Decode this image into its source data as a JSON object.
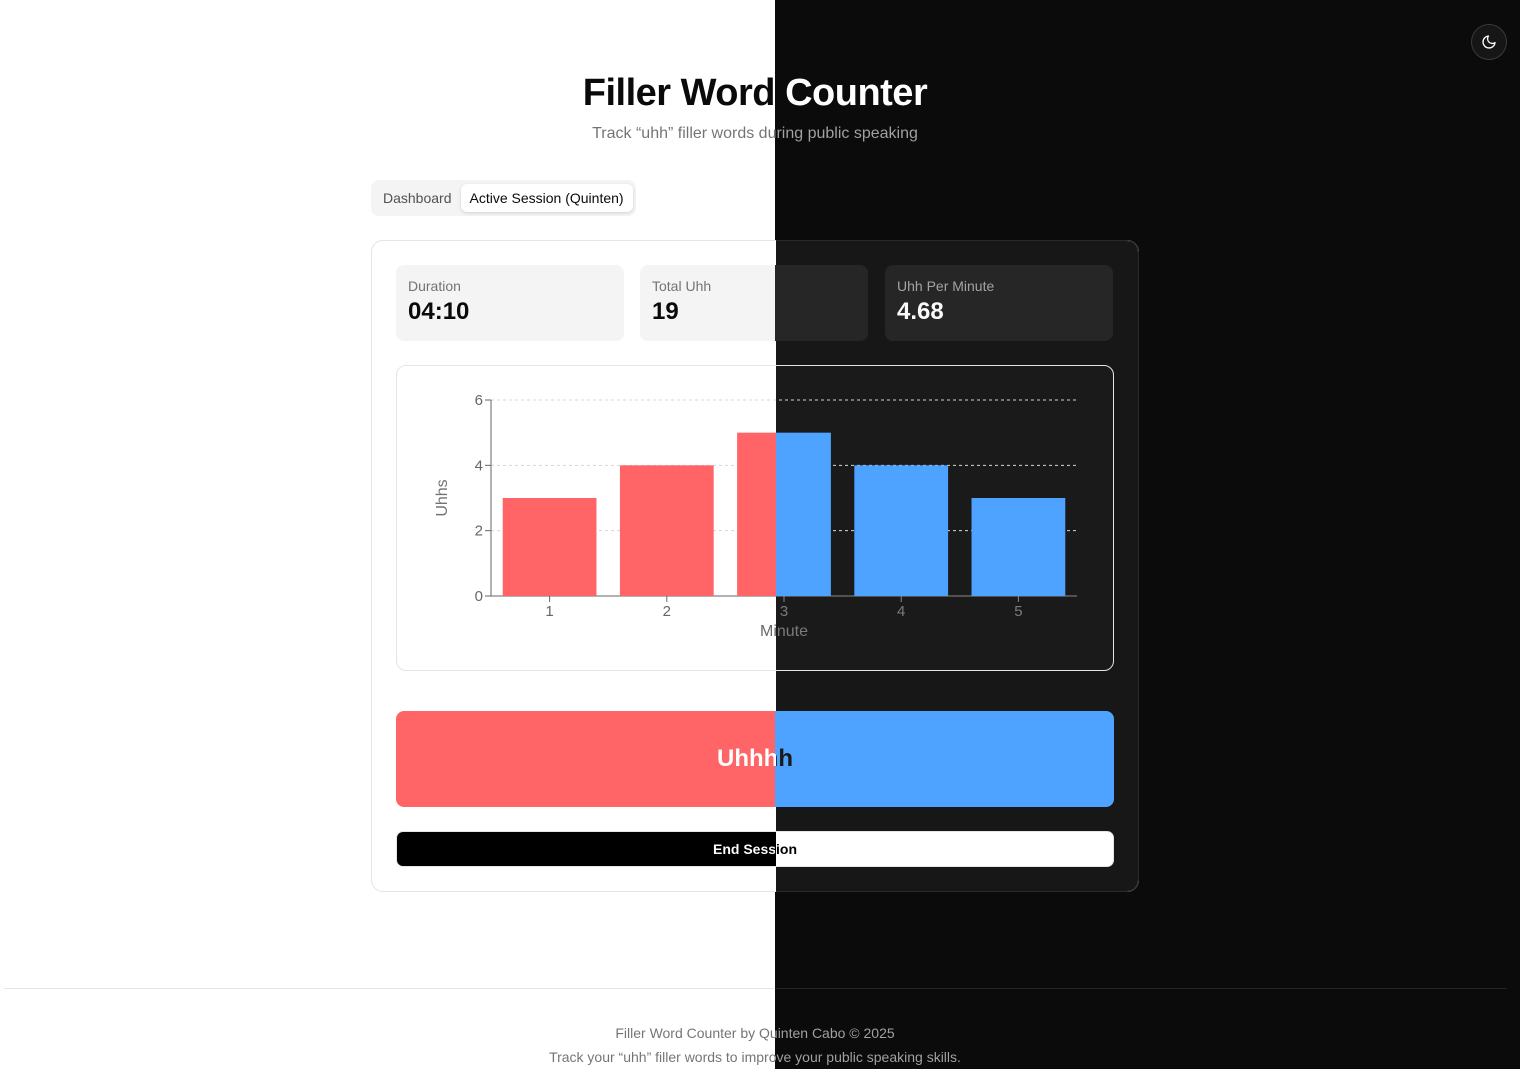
{
  "header": {
    "title": "Filler Word Counter",
    "subtitle": "Track “uhh” filler words during public speaking"
  },
  "theme_toggle": {
    "icon": "moon-icon"
  },
  "tabs": [
    {
      "label": "Dashboard",
      "active": false
    },
    {
      "label": "Active Session (Quinten)",
      "active": true
    }
  ],
  "stats": {
    "duration": {
      "label": "Duration",
      "value": "04:10"
    },
    "total": {
      "label": "Total Uhh",
      "value": "19"
    },
    "per_minute": {
      "label": "Uhh Per Minute",
      "value": "4.68"
    }
  },
  "chart_data": {
    "type": "bar",
    "categories": [
      "1",
      "2",
      "3",
      "4",
      "5"
    ],
    "values": [
      3,
      4,
      5,
      4,
      3
    ],
    "xlabel": "Minute",
    "ylabel": "Uhhs",
    "ylim": [
      0,
      6
    ],
    "yticks": [
      "0",
      "2",
      "4",
      "6"
    ],
    "grid": true,
    "colors": {
      "light": "#ff6466",
      "dark": "#4da3ff"
    }
  },
  "actions": {
    "uh_label": "Uhhhh",
    "end_label": "End Session"
  },
  "footer": {
    "line1": "Filler Word Counter by Quinten Cabo © 2025",
    "line2": "Track your “uhh” filler words to improve your public speaking skills."
  }
}
